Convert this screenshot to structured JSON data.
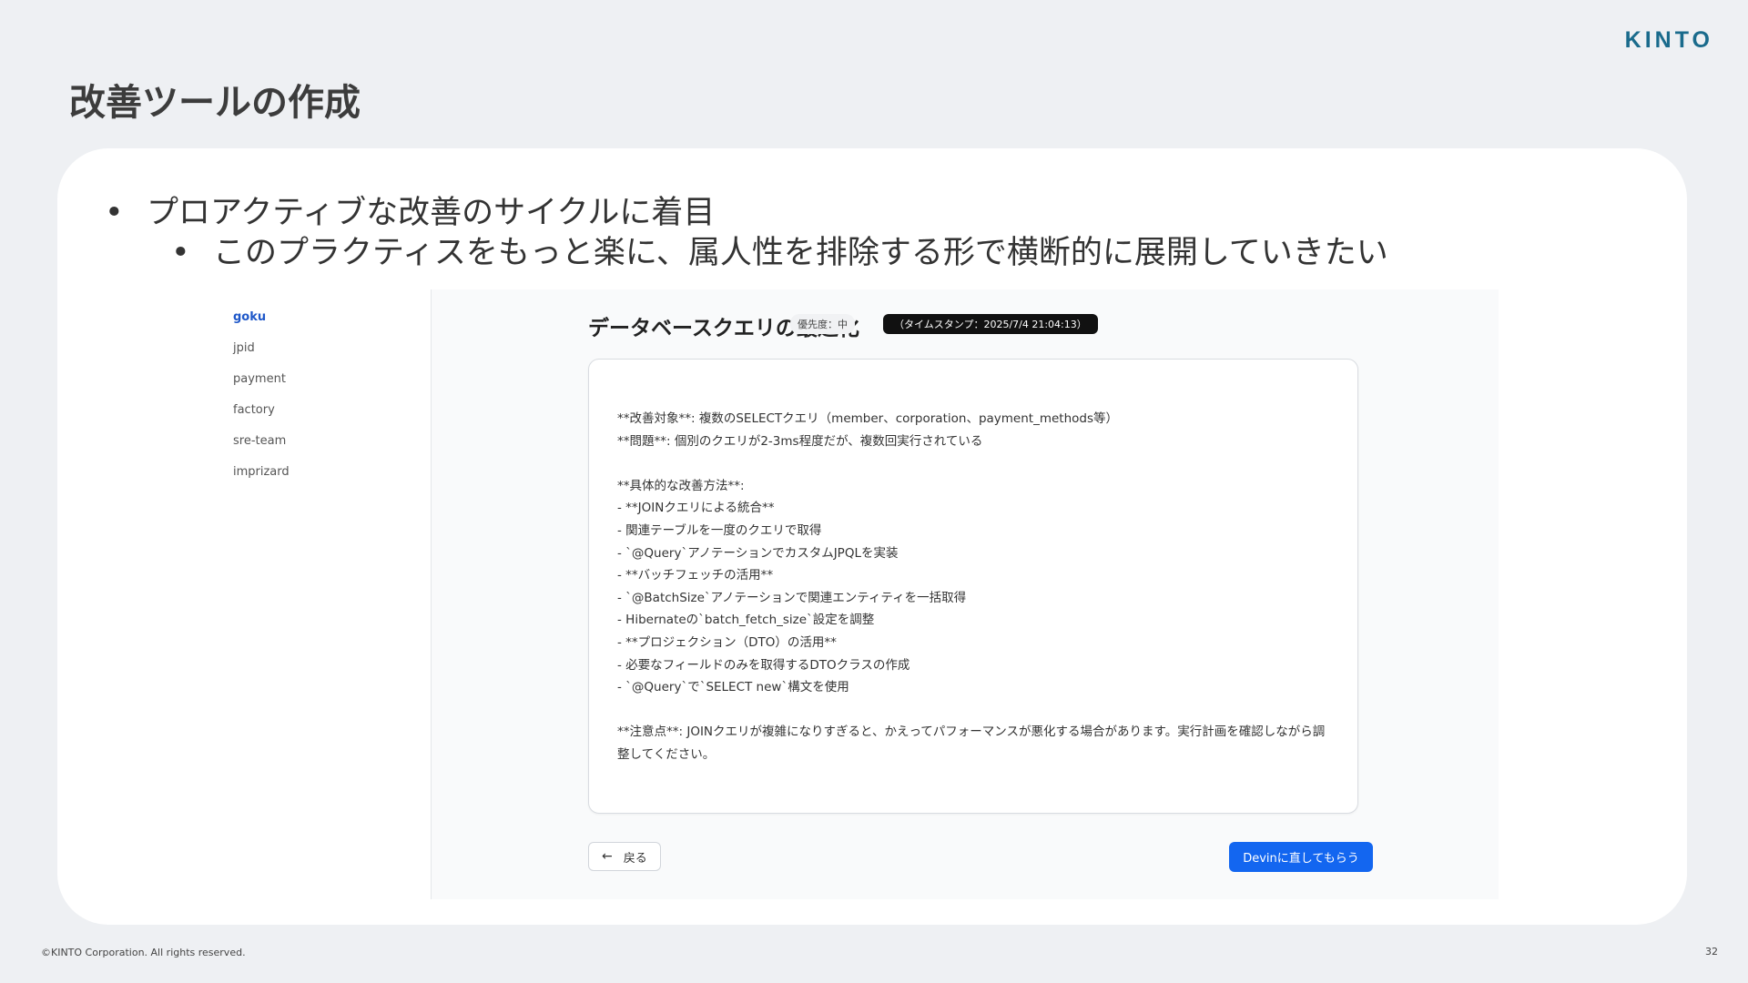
{
  "logo": {
    "text": "KINTO"
  },
  "slide": {
    "title": "改善ツールの作成",
    "bullets": [
      {
        "marker": "•",
        "text": "プロアクティブな改善のサイクルに着目"
      },
      {
        "marker": "•",
        "text": "このプラクティスをもっと楽に、属人性を排除する形で横断的に展開していきたい"
      }
    ]
  },
  "screenshot": {
    "sidebar": {
      "items": [
        {
          "label": "goku",
          "active": true
        },
        {
          "label": "jpid",
          "active": false
        },
        {
          "label": "payment",
          "active": false
        },
        {
          "label": "factory",
          "active": false
        },
        {
          "label": "sre-team",
          "active": false
        },
        {
          "label": "imprizard",
          "active": false
        }
      ]
    },
    "issue": {
      "title": "データベースクエリの最適化",
      "priority": "優先度：中",
      "timestamp": "（タイムスタンプ：2025/7/4 21:04:13）",
      "body": "**改善対象**: 複数のSELECTクエリ（member、corporation、payment_methods等）\n**問題**: 個別のクエリが2-3ms程度だが、複数回実行されている\n\n**具体的な改善方法**:\n- **JOINクエリによる統合**\n- 関連テーブルを一度のクエリで取得\n- `@Query`アノテーションでカスタムJPQLを実装\n- **バッチフェッチの活用**\n- `@BatchSize`アノテーションで関連エンティティを一括取得\n- Hibernateの`batch_fetch_size`設定を調整\n- **プロジェクション（DTO）の活用**\n- 必要なフィールドのみを取得するDTOクラスの作成\n- `@Query`で`SELECT new`構文を使用\n\n**注意点**: JOINクエリが複雑になりすぎると、かえってパフォーマンスが悪化する場合があります。実行計画を確認しながら調整してください。"
    },
    "actions": {
      "back_icon": "←",
      "back_label": "戻る",
      "devin_label": "Devinに直してもらう"
    }
  },
  "footer": {
    "copyright": "©KINTO Corporation. All rights reserved.",
    "page_number": "32"
  }
}
